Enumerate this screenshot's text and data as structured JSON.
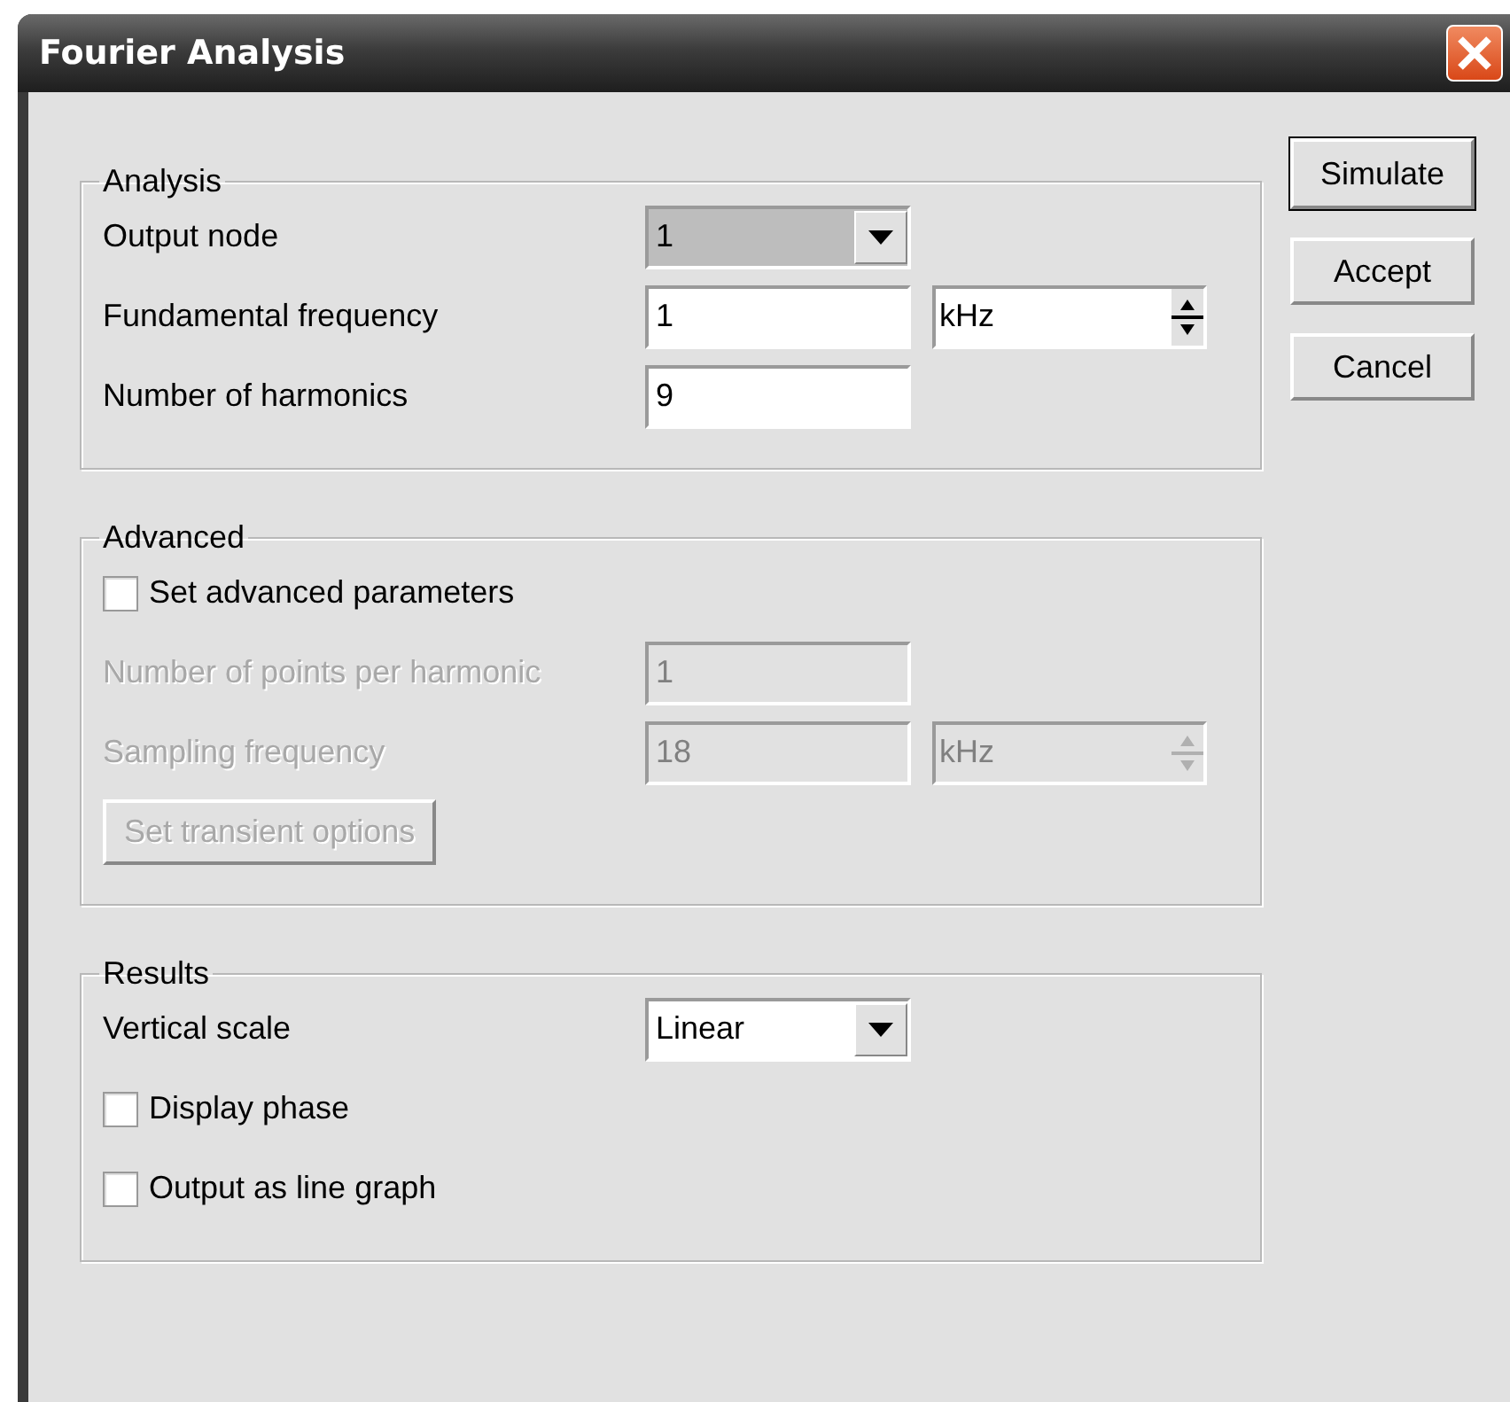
{
  "window": {
    "title": "Fourier Analysis"
  },
  "groups": [
    {
      "title": "Analysis",
      "rows": [
        {
          "kind": "dropdown",
          "label": "Output node",
          "value": "1",
          "disabled": false,
          "selected": true
        },
        {
          "kind": "field_unit",
          "label": "Fundamental frequency",
          "value": "1",
          "unit": "kHz",
          "disabled": false
        },
        {
          "kind": "field",
          "label": "Number of harmonics",
          "value": "9",
          "disabled": false
        }
      ]
    },
    {
      "title": "Advanced",
      "rows": [
        {
          "kind": "checkbox",
          "label": "Set advanced parameters",
          "checked": false,
          "disabled": false
        },
        {
          "kind": "field",
          "label": "Number of points per harmonic",
          "value": "1",
          "disabled": true
        },
        {
          "kind": "field_unit",
          "label": "Sampling frequency",
          "value": "18",
          "unit": "kHz",
          "disabled": true
        },
        {
          "kind": "button",
          "label": "Set transient options",
          "disabled": true
        }
      ]
    },
    {
      "title": "Results",
      "rows": [
        {
          "kind": "dropdown",
          "label": "Vertical scale",
          "value": "Linear",
          "disabled": false,
          "selected": false
        },
        {
          "kind": "checkbox",
          "label": "Display phase",
          "checked": false,
          "disabled": false
        },
        {
          "kind": "checkbox",
          "label": "Output as line graph",
          "checked": false,
          "disabled": false
        }
      ]
    }
  ],
  "buttons": [
    {
      "label": "Simulate",
      "default": true
    },
    {
      "label": "Accept",
      "default": false
    },
    {
      "label": "Cancel",
      "default": false
    }
  ]
}
